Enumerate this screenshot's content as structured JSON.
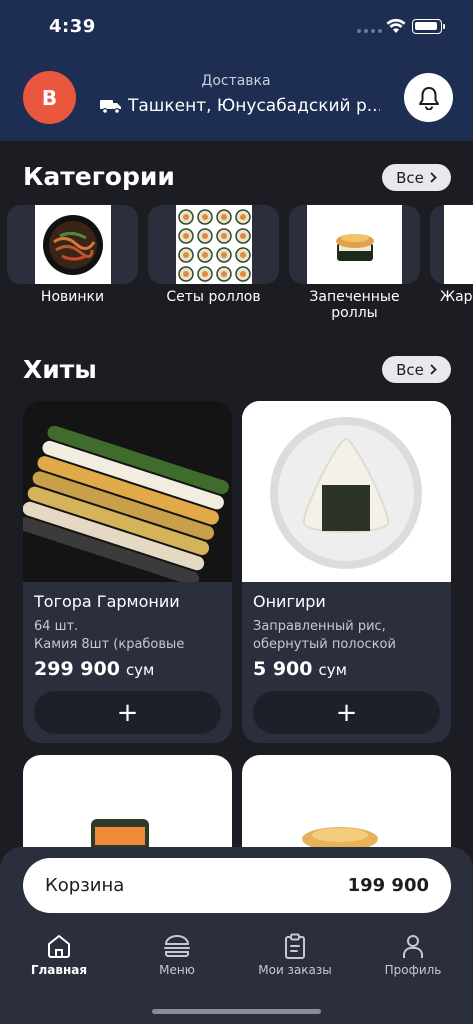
{
  "status_bar": {
    "time": "4:39"
  },
  "header": {
    "avatar_letter": "B",
    "delivery_label": "Доставка",
    "address": "Ташкент, Юнусабадский р..."
  },
  "categories": {
    "title": "Категории",
    "all_label": "Все",
    "items": [
      {
        "label": "Новинки"
      },
      {
        "label": "Сеты роллов"
      },
      {
        "label": "Запеченные роллы"
      },
      {
        "label": "Жаре"
      }
    ]
  },
  "hits": {
    "title": "Хиты",
    "all_label": "Все",
    "products": [
      {
        "name": "Тогора Гармонии",
        "desc1": "64 шт.",
        "desc2": "Камия 8шт (крабовые",
        "price": "299 900",
        "currency": "сум",
        "add": "+"
      },
      {
        "name": "Онигири",
        "desc1": "Заправленный рис,",
        "desc2": "обернутый полоской",
        "price": "5 900",
        "currency": "сум",
        "add": "+"
      }
    ]
  },
  "cart": {
    "label": "Корзина",
    "total": "199 900"
  },
  "nav": {
    "items": [
      {
        "label": "Главная",
        "icon": "home-icon",
        "active": true
      },
      {
        "label": "Меню",
        "icon": "burger-icon",
        "active": false
      },
      {
        "label": "Мои заказы",
        "icon": "clipboard-icon",
        "active": false
      },
      {
        "label": "Профиль",
        "icon": "user-icon",
        "active": false
      }
    ]
  },
  "colors": {
    "header_bg": "#1d2e52",
    "avatar": "#e9573f",
    "page_bg": "#1c1d22",
    "card_bg": "#2b2e3c"
  }
}
